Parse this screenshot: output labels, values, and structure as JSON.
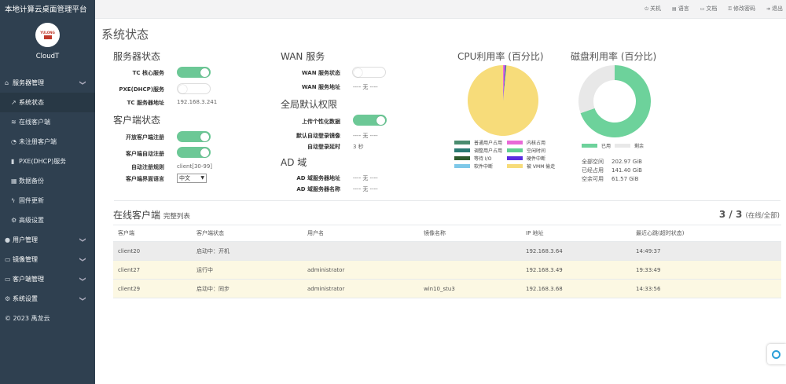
{
  "brand": "本地计算云桌面管理平台",
  "logo_text": "YULONG",
  "profile_name": "CloudT",
  "nav": [
    {
      "label": "服务器管理",
      "icon": "home-icon",
      "glyph": "⌂",
      "top": true,
      "chev": "❯"
    },
    {
      "label": "系统状态",
      "icon": "line-chart-icon",
      "glyph": "↗",
      "sub": true,
      "active": true
    },
    {
      "label": "在线客户端",
      "icon": "wifi-icon",
      "glyph": "≋",
      "sub": true
    },
    {
      "label": "未注册客户端",
      "icon": "rss-icon",
      "glyph": "◔",
      "sub": true
    },
    {
      "label": "PXE(DHCP)服务",
      "icon": "signal-icon",
      "glyph": "▮",
      "sub": true
    },
    {
      "label": "数据备份",
      "icon": "calendar-icon",
      "glyph": "▦",
      "sub": true
    },
    {
      "label": "固件更新",
      "icon": "bolt-icon",
      "glyph": "ϟ",
      "sub": true
    },
    {
      "label": "高级设置",
      "icon": "cogs-icon",
      "glyph": "⚙",
      "sub": true
    },
    {
      "label": "用户管理",
      "icon": "user-icon",
      "glyph": "●",
      "top": true,
      "chev": "❯"
    },
    {
      "label": "镜像管理",
      "icon": "hdd-icon",
      "glyph": "▭",
      "top": true,
      "chev": "❯"
    },
    {
      "label": "客户端管理",
      "icon": "desktop-icon",
      "glyph": "▭",
      "top": true,
      "chev": "❯"
    },
    {
      "label": "系统设置",
      "icon": "cog-icon",
      "glyph": "⚙",
      "top": true,
      "chev": "❯"
    }
  ],
  "copyright": "© 2023 禹龙云",
  "toplinks": [
    {
      "label": "关机",
      "icon": "power-icon",
      "glyph": "⏻"
    },
    {
      "label": "语言",
      "icon": "language-icon",
      "glyph": "▤"
    },
    {
      "label": "文档",
      "icon": "document-icon",
      "glyph": "▭"
    },
    {
      "label": "修改密码",
      "icon": "lock-icon",
      "glyph": "⚿"
    },
    {
      "label": "退出",
      "icon": "sign-out-icon",
      "glyph": "➜"
    }
  ],
  "page_title": "系统状态",
  "server_status": {
    "title": "服务器状态",
    "tc_label": "TC 核心服务",
    "pxe_label": "PXE(DHCP)服务",
    "addr_label": "TC 服务器地址",
    "addr_value": "192.168.3.241"
  },
  "client_status": {
    "title": "客户端状态",
    "open_reg_label": "开放客户端注册",
    "auto_reg_label": "客户端自动注册",
    "reg_rule_label": "自动注册规则",
    "reg_rule_value": "client[30-99]",
    "lang_label": "客户端界面语言",
    "lang_value": "中文"
  },
  "wan": {
    "title": "WAN 服务",
    "status_label": "WAN 服务状态",
    "addr_label": "WAN 服务地址",
    "addr_value": "---- 无 ----"
  },
  "global_perm": {
    "title": "全局默认权限",
    "upload_label": "上传个性化数据",
    "default_login_image_label": "默认自动登录镜像",
    "default_login_image_value": "---- 无 ----",
    "login_delay_label": "自动登录延时",
    "login_delay_value": "3 秒"
  },
  "ad": {
    "title": "AD 域",
    "addr_label": "AD 域服务器地址",
    "addr_value": "---- 无 ----",
    "name_label": "AD 域服务器名称",
    "name_value": "---- 无 ----"
  },
  "cpu": {
    "title": "CPU利用率 (百分比)",
    "legend": [
      {
        "label": "普通用户占用",
        "color": "#4a8c6f"
      },
      {
        "label": "内核占用",
        "color": "#e86ad6"
      },
      {
        "label": "调整用户占用",
        "color": "#2a7a72"
      },
      {
        "label": "空闲时间",
        "color": "#5fcf91"
      },
      {
        "label": "等待 I/O",
        "color": "#2e5b2e"
      },
      {
        "label": "硬件中断",
        "color": "#5a2de0"
      },
      {
        "label": "软件中断",
        "color": "#7ec8e8"
      },
      {
        "label": "被 VMM 偷走",
        "color": "#f7dc7a"
      }
    ],
    "slices": [
      {
        "name": "被 VMM 偷走",
        "value": 98.5,
        "color": "#f7dc7a"
      },
      {
        "name": "内核占用",
        "value": 0.8,
        "color": "#e86ad6"
      },
      {
        "name": "硬件中断",
        "value": 0.4,
        "color": "#5a2de0"
      },
      {
        "name": "普通用户占用",
        "value": 0.3,
        "color": "#4a8c6f"
      }
    ]
  },
  "disk": {
    "title": "磁盘利用率 (百分比)",
    "used_label": "已用",
    "free_label": "剩余",
    "used_color": "#6dd29b",
    "free_color": "#e8e8e8",
    "used_fraction": 0.6966,
    "stats": [
      {
        "label": "全部空间",
        "value": "202.97 GiB"
      },
      {
        "label": "已经占用",
        "value": "141.40 GiB"
      },
      {
        "label": "空余可用",
        "value": "61.57 GiB"
      }
    ]
  },
  "online": {
    "title": "在线客户端",
    "subtitle": "完整列表",
    "count": "3 / 3",
    "count_suffix": "(在线/全部)",
    "headers": [
      "客户端",
      "客户端状态",
      "用户名",
      "镜像名称",
      "IP 地址",
      "最近心跳(超时状态)"
    ],
    "rows": [
      {
        "cells": [
          "client20",
          "启动中：开机",
          "",
          "",
          "192.168.3.64",
          "14:49:37"
        ],
        "style": "grey"
      },
      {
        "cells": [
          "client27",
          "运行中",
          "administrator",
          "",
          "192.168.3.49",
          "19:33:49"
        ],
        "style": "yellow"
      },
      {
        "cells": [
          "client29",
          "启动中：同步",
          "administrator",
          "win10_stu3",
          "192.168.3.68",
          "14:33:56"
        ],
        "style": "yellow"
      }
    ]
  }
}
